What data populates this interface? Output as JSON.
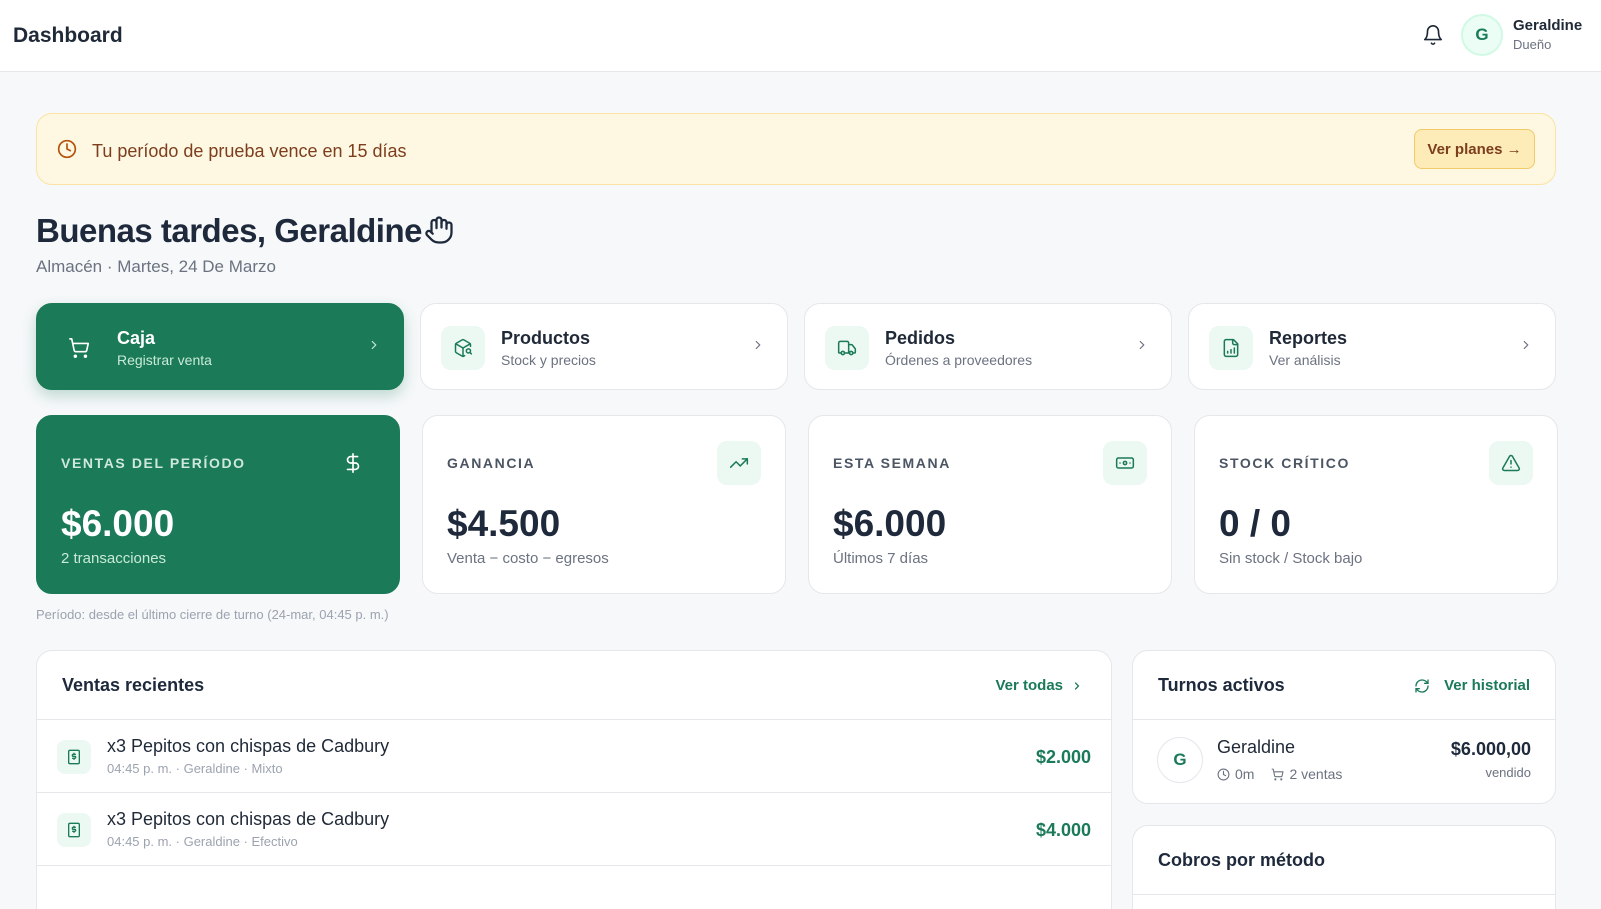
{
  "header": {
    "title": "Dashboard"
  },
  "user": {
    "initial": "G",
    "name": "Geraldine",
    "role": "Dueño"
  },
  "trial_banner": {
    "message": "Tu período de prueba vence en 15 días",
    "button": "Ver planes →"
  },
  "greeting": {
    "title": "Buenas tardes, Geraldine",
    "subtitle": "Almacén · Martes, 24 De Marzo"
  },
  "actions": [
    {
      "title": "Caja",
      "subtitle": "Registrar venta",
      "icon": "cart-icon"
    },
    {
      "title": "Productos",
      "subtitle": "Stock y precios",
      "icon": "package-search-icon"
    },
    {
      "title": "Pedidos",
      "subtitle": "Órdenes a proveedores",
      "icon": "truck-icon"
    },
    {
      "title": "Reportes",
      "subtitle": "Ver análisis",
      "icon": "report-icon"
    }
  ],
  "stats": [
    {
      "label": "VENTAS DEL PERÍODO",
      "value": "$6.000",
      "sub": "2 transacciones",
      "icon": "dollar-icon"
    },
    {
      "label": "GANANCIA",
      "value": "$4.500",
      "sub": "Venta − costo − egresos",
      "icon": "trending-up-icon"
    },
    {
      "label": "ESTA SEMANA",
      "value": "$6.000",
      "sub": "Últimos 7 días",
      "icon": "banknote-icon"
    },
    {
      "label": "STOCK CRÍTICO",
      "value": "0 / 0",
      "sub": "Sin stock / Stock bajo",
      "icon": "warning-icon"
    }
  ],
  "period_note": "Período: desde el último cierre de turno (24-mar, 04:45 p. m.)",
  "recent_sales": {
    "title": "Ventas recientes",
    "link": "Ver todas",
    "items": [
      {
        "name": "x3 Pepitos con chispas de Cadbury",
        "meta": "04:45 p. m. · Geraldine · Mixto",
        "amount": "$2.000"
      },
      {
        "name": "x3 Pepitos con chispas de Cadbury",
        "meta": "04:45 p. m. · Geraldine · Efectivo",
        "amount": "$4.000"
      }
    ]
  },
  "active_shifts": {
    "title": "Turnos activos",
    "link": "Ver historial",
    "items": [
      {
        "initial": "G",
        "name": "Geraldine",
        "duration": "0m",
        "sales": "2 ventas",
        "amount": "$6.000,00",
        "amount_label": "vendido"
      }
    ]
  },
  "payments": {
    "title": "Cobros por método"
  },
  "colors": {
    "brand": "#1b7a57",
    "banner_bg": "#fef7e2",
    "banner_text": "#7c3e1d"
  }
}
